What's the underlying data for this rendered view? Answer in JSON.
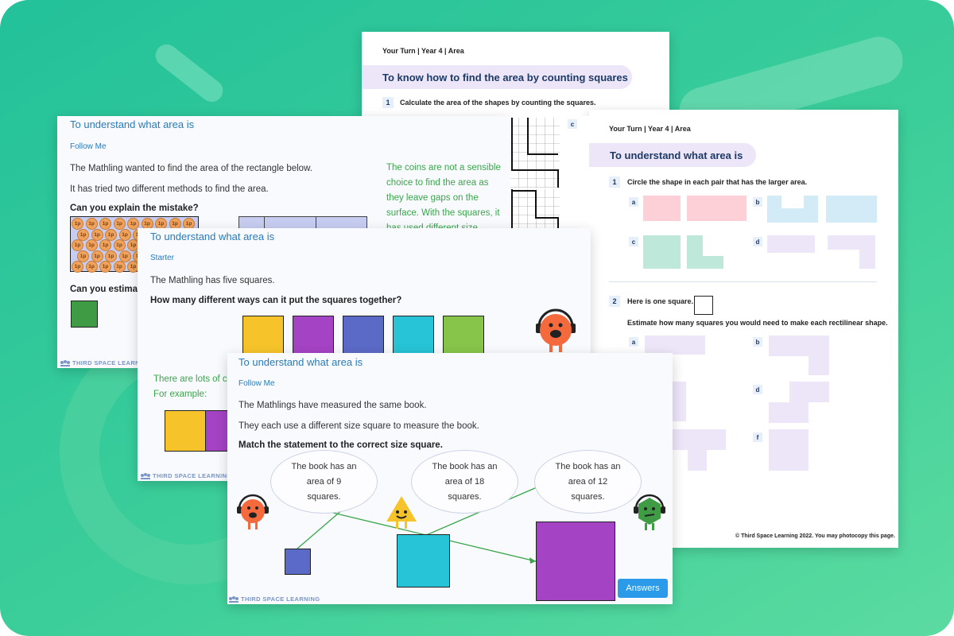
{
  "colors": {
    "background": "#2fc79c",
    "slide_title": "#2a7bb8",
    "green_text": "#3aa64a",
    "answers_button": "#2b9ae8"
  },
  "worksheet_back": {
    "header": "Your Turn | Year 4 | Area",
    "title": "To know how to find the area by counting squares",
    "q1_num": "1",
    "q1_text": "Calculate the area of the shapes by counting the squares.",
    "label_c": "c"
  },
  "worksheet_front": {
    "header": "Your Turn | Year 4 | Area",
    "title": "To understand what area is",
    "q1": {
      "num": "1",
      "text": "Circle the shape in each pair that has the larger area.",
      "labels": [
        "a",
        "b",
        "c",
        "d"
      ]
    },
    "q2": {
      "num": "2",
      "text": "Here is one square.",
      "text2": "Estimate how many squares you would need to make each rectilinear shape.",
      "labels": [
        "a",
        "b",
        "d",
        "f"
      ]
    },
    "footer": "© Third Space Learning 2022. You may photocopy this page."
  },
  "slide_back": {
    "title": "To understand what area is",
    "section": "Follow Me",
    "line1": "The Mathling wanted to find the area of the rectangle below.",
    "line2": "It has tried two different methods to find the area.",
    "question": "Can you explain the mistake?",
    "coin_label": "1p",
    "estimate_question": "Can you estimat",
    "explanation": "The coins are not a sensible choice to find the area as they leave gaps on the surface. With the squares, it has used different size",
    "brand": "THIRD SPACE LEARNING"
  },
  "slide_middle": {
    "title": "To understand what area is",
    "section": "Starter",
    "line1": "The Mathling has five squares.",
    "question": "How many different ways can it put the squares together?",
    "square_colors": [
      "#f6c42a",
      "#a443c4",
      "#5b6ac6",
      "#27c3d6",
      "#86c44a"
    ],
    "answer_line1": "There are lots of c",
    "answer_line2": "For example:",
    "brand": "THIRD SPACE LEARNING"
  },
  "slide_front": {
    "title": "To understand what area is",
    "section": "Follow Me",
    "line1": "The Mathlings have measured the same book.",
    "line2": "They each use a different size square to measure the book.",
    "question": "Match the statement to the correct size square.",
    "bubbles": [
      {
        "l1": "The book has an",
        "l2": "area of 9",
        "l3": "squares."
      },
      {
        "l1": "The book has an",
        "l2": "area of 18",
        "l3": "squares."
      },
      {
        "l1": "The book has an",
        "l2": "area of 12",
        "l3": "squares."
      }
    ],
    "answers_button": "Answers",
    "brand": "THIRD SPACE LEARNING"
  }
}
